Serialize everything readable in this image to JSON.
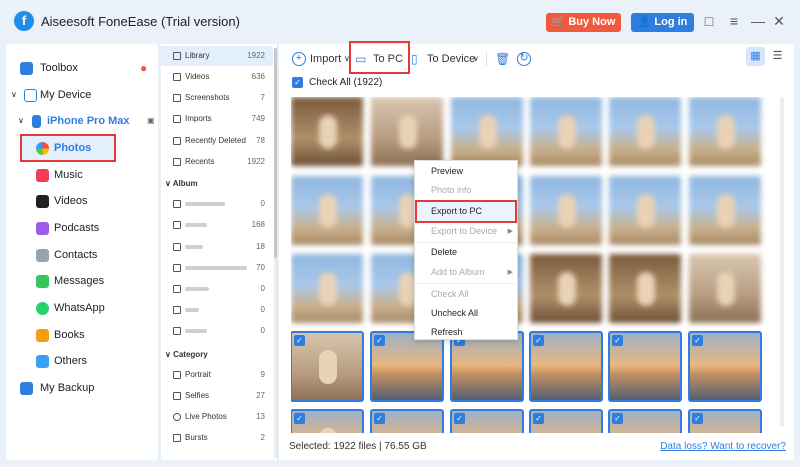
{
  "app": {
    "title": "Aiseesoft FoneEase (Trial version)",
    "logo_letter": "f",
    "buy_label": "Buy Now",
    "login_label": "Log in"
  },
  "sidebar": {
    "toolbox": "Toolbox",
    "my_device": "My Device",
    "device_name": "iPhone Pro Max",
    "items": [
      "Photos",
      "Music",
      "Videos",
      "Podcasts",
      "Contacts",
      "Messages",
      "WhatsApp",
      "Books",
      "Others"
    ],
    "my_backup": "My Backup"
  },
  "library": {
    "rows": [
      {
        "name": "Library",
        "count": "1922"
      },
      {
        "name": "Videos",
        "count": "636"
      },
      {
        "name": "Screenshots",
        "count": "7"
      },
      {
        "name": "Imports",
        "count": "749"
      },
      {
        "name": "Recently Deleted",
        "count": "78"
      },
      {
        "name": "Recents",
        "count": "1922"
      }
    ],
    "album_header": "Album",
    "albums": [
      {
        "count": "0"
      },
      {
        "count": "168"
      },
      {
        "count": "18"
      },
      {
        "count": "70"
      },
      {
        "count": "0"
      },
      {
        "count": "0"
      },
      {
        "count": "0"
      }
    ],
    "category_header": "Category",
    "categories": [
      {
        "name": "Portrait",
        "count": "9"
      },
      {
        "name": "Selfies",
        "count": "27"
      },
      {
        "name": "Live Photos",
        "count": "13"
      },
      {
        "name": "Bursts",
        "count": "2"
      }
    ]
  },
  "toolbar": {
    "import": "Import",
    "to_pc": "To PC",
    "to_device": "To Device"
  },
  "check_all": "Check All (1922)",
  "context_menu": {
    "items": [
      {
        "label": "Preview",
        "disabled": false
      },
      {
        "label": "Photo info",
        "disabled": true
      },
      {
        "label": "Export to PC",
        "disabled": false
      },
      {
        "label": "Export to Device",
        "disabled": true
      },
      {
        "label": "Delete",
        "disabled": false
      },
      {
        "label": "Add to Album",
        "disabled": true
      },
      {
        "label": "Check All",
        "disabled": true
      },
      {
        "label": "Uncheck All",
        "disabled": false
      },
      {
        "label": "Refresh",
        "disabled": false
      }
    ]
  },
  "status": {
    "selected": "Selected: 1922 files | 76.55 GB",
    "recover_link": "Data loss? Want to recover?"
  },
  "colors": {
    "accent": "#2f7ddf",
    "buy": "#f05a3c",
    "highlight": "#e53935"
  }
}
